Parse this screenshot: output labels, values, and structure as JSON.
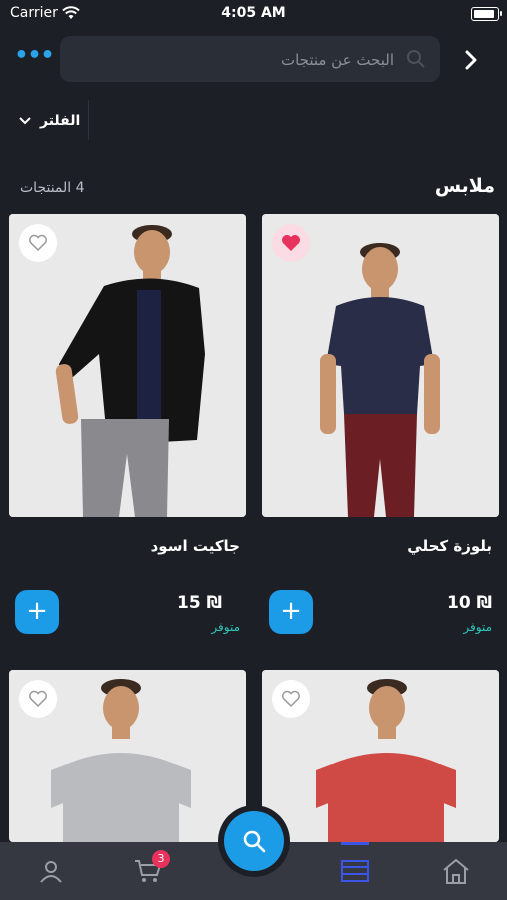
{
  "status_bar": {
    "carrier": "Carrier",
    "time": "4:05 AM"
  },
  "search": {
    "placeholder": "البحث عن منتجات"
  },
  "filter": {
    "label": "الفلتر"
  },
  "section": {
    "title": "ملابس",
    "count": "4 المنتجات"
  },
  "products": [
    {
      "name": "بلوزة كحلي",
      "price": "₪ 10",
      "stock": "متوفر",
      "favorite": true
    },
    {
      "name": "جاكيت اسود",
      "price": "₪ 15",
      "stock": "متوفر",
      "favorite": false
    },
    {
      "favorite": false
    },
    {
      "favorite": false
    }
  ],
  "tab_bar": {
    "cart_badge": "3"
  },
  "colors": {
    "accent": "#1c9be6",
    "background": "#1c1f26",
    "stock": "#2ec4b6",
    "favorite": "#e8325e",
    "badge": "#e8325e"
  }
}
